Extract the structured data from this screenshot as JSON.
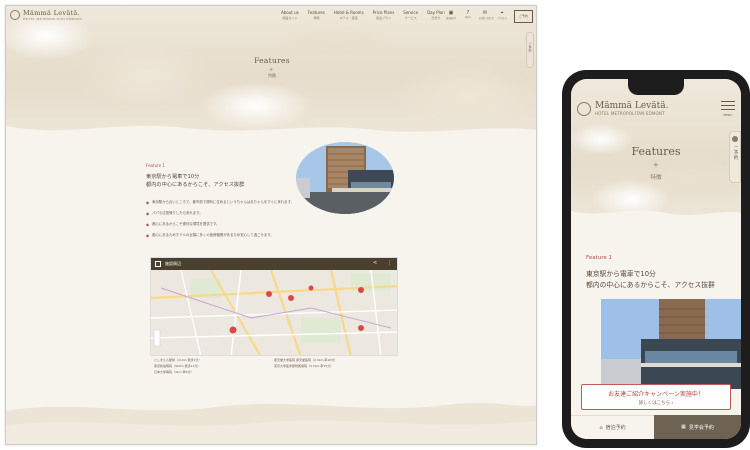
{
  "site": {
    "logo": "Mämmä Levätä.",
    "logo_sub": "HOTEL METROPOLITAN EDMONT",
    "book_label": "ご予約"
  },
  "nav": [
    {
      "en": "About us",
      "jp": "施設ガイド"
    },
    {
      "en": "Features",
      "jp": "特徴"
    },
    {
      "en": "Hotel & Rooms",
      "jp": "ホテル・客室"
    },
    {
      "en": "Price Plans",
      "jp": "宿泊プラン"
    },
    {
      "en": "Service",
      "jp": "サービス"
    },
    {
      "en": "Day Plan",
      "jp": "日帰り"
    }
  ],
  "header_icons": [
    {
      "glyph": "▣",
      "label": "客室紹介"
    },
    {
      "glyph": "?",
      "label": "Q&A"
    },
    {
      "glyph": "✉",
      "label": "お問い合わせ"
    },
    {
      "glyph": "⌖",
      "label": "アクセス"
    }
  ],
  "hero": {
    "title": "Features",
    "dot": "+",
    "subtitle": "特徴"
  },
  "side_tab": "ご予約",
  "feature": {
    "label": "Feature 1",
    "heading_line1": "東京駅から電車で10分",
    "heading_line2": "都内の中心にあるからこそ、アクセス抜群"
  },
  "feature_points": [
    "東京駅から近いところで、都市部で便利に住めるというちゃんはあちゃんをすぐに来れます。",
    "パパも往復帰りしたら来れます。",
    "都心にあるからこそ便利な環境を提供です。",
    "都心にあるためホテルの近隣に多くの医療機関があるため安心して過ごせます。"
  ],
  "map": {
    "title": "施設周辺",
    "share_glyph": "<",
    "more_glyph": "⋮"
  },
  "stations": [
    "としまえん駅前（110m 徒歩1分）",
    "順天堂大学医院 順天堂医院（2.3km 車10分）",
    "東京新宿病院（900m 徒歩11分）",
    "東京大学医学部附属病院（3.7km 車15分）",
    "日本大学病院（3km 車6分）"
  ],
  "phone": {
    "menu_label": "MENU",
    "title": "Features",
    "dot": "+",
    "subtitle": "特徴",
    "side_label": "ご予約",
    "feature_label": "Feature 1",
    "heading_line1": "東京駅から電車で10分",
    "heading_line2": "都内の中心にあるからこそ、アクセス抜群",
    "campaign_title": "お友達ご紹介キャンペーン実施中！",
    "campaign_sub": "詳しくはこちら ›",
    "bar_left": "宿泊予約",
    "bar_right": "見学会予約"
  },
  "colors": {
    "accent": "#b25050",
    "text": "#6b5a4a",
    "dark_bar": "#6e6253",
    "background": "#f7f4ee"
  }
}
